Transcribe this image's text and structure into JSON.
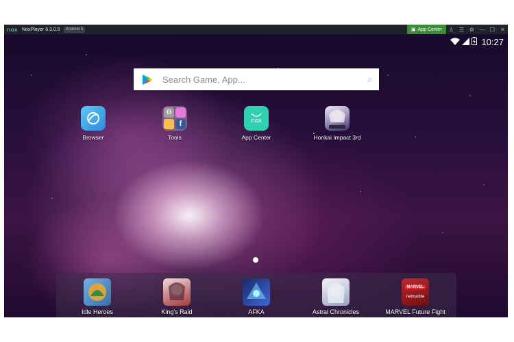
{
  "window": {
    "logo": "nox",
    "title": "NoxPlayer 6.3.0.5",
    "android_badge": "Android 5",
    "app_center_button": "App Center",
    "controls": [
      "shirt-icon",
      "menu-icon",
      "gear-icon",
      "minimize-icon",
      "maximize-icon",
      "close-icon"
    ]
  },
  "status": {
    "time": "10:27",
    "icons": [
      "wifi-icon",
      "signal-icon",
      "battery-icon"
    ]
  },
  "search": {
    "placeholder": "Search Game, App..."
  },
  "home_apps": [
    {
      "label": "Browser",
      "icon": "browser-icon"
    },
    {
      "label": "Tools",
      "icon": "tools-folder-icon"
    },
    {
      "label": "App Center",
      "icon": "app-center-icon",
      "icon_text": "nox"
    },
    {
      "label": "Honkai Impact 3rd",
      "icon": "honkai-impact-icon"
    }
  ],
  "dock_apps": [
    {
      "label": "Idle Heroes",
      "icon": "idle-heroes-icon"
    },
    {
      "label": "King's Raid",
      "icon": "kings-raid-icon"
    },
    {
      "label": "AFKA",
      "icon": "afka-icon"
    },
    {
      "label": "Astral Chronicles",
      "icon": "astral-chronicles-icon"
    },
    {
      "label": "MARVEL Future Fight",
      "icon": "marvel-future-fight-icon",
      "icon_text": [
        "MARVEL",
        "netmarble"
      ]
    }
  ],
  "colors": {
    "app_center_green": "#3f8a3a",
    "titlebar": "#1f2229",
    "browser_blue": "#3aa8ea",
    "appcenter_teal": "#2ed1b0"
  }
}
